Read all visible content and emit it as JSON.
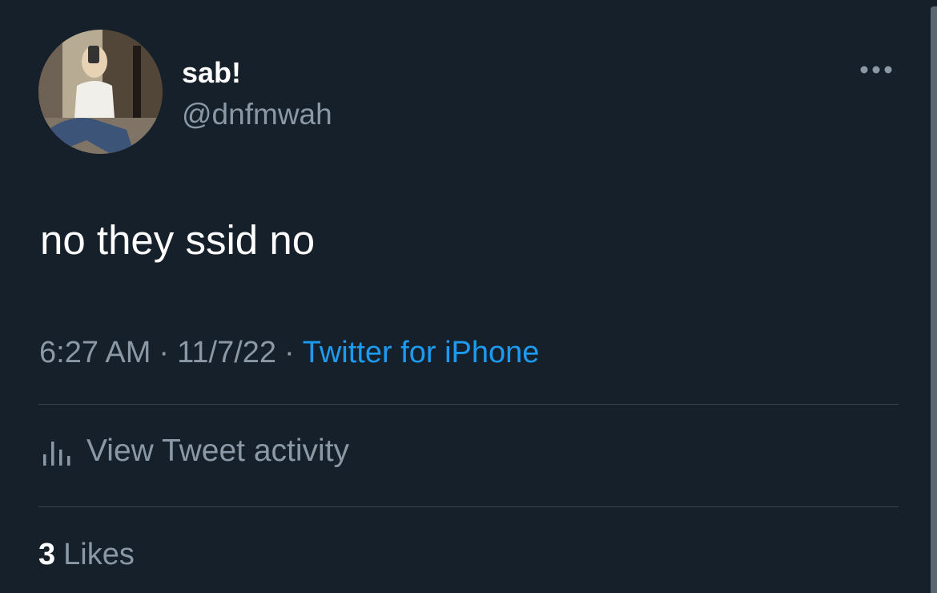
{
  "tweet": {
    "display_name": "sab!",
    "handle": "@dnfmwah",
    "text": "no they ssid no",
    "time": "6:27 AM",
    "date": "11/7/22",
    "source": "Twitter for iPhone",
    "separator": "·"
  },
  "actions": {
    "activity_label": "View Tweet activity"
  },
  "stats": {
    "likes_count": "3",
    "likes_label": "Likes"
  },
  "colors": {
    "background": "#15202b",
    "primary_text": "#ffffff",
    "secondary_text": "#8b98a5",
    "link": "#1d9bf0",
    "divider": "#38444d"
  },
  "icons": {
    "more": "more-horizontal-icon",
    "activity": "bar-chart-icon"
  }
}
